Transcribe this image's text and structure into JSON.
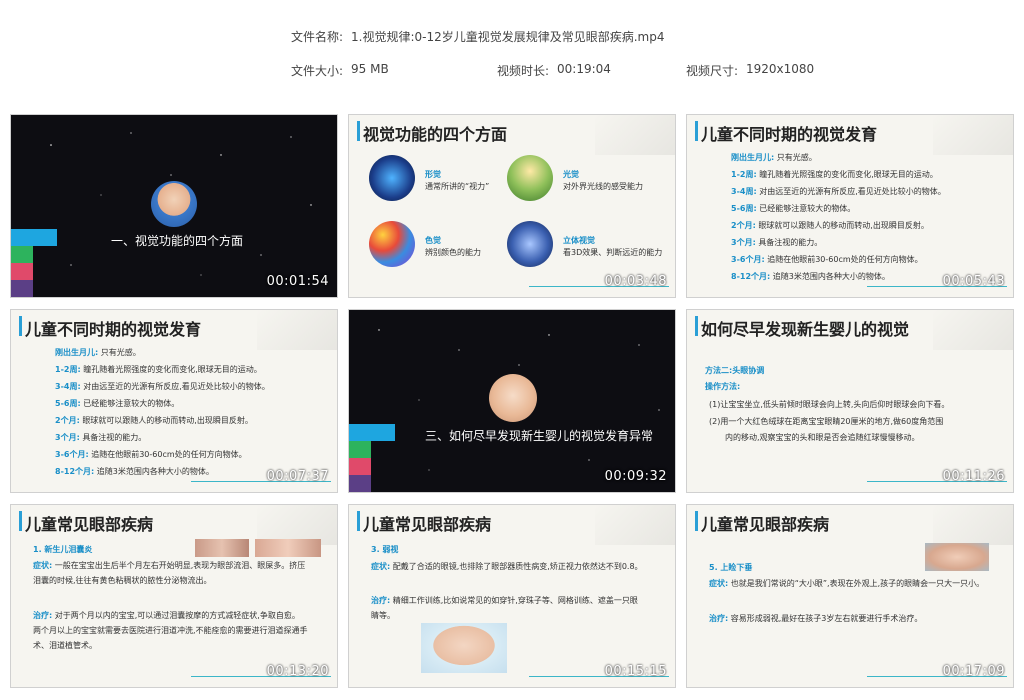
{
  "file_info": {
    "name_label": "文件名称:",
    "name_value": "1.视觉规律:0-12岁儿童视觉发展规律及常见眼部疾病.mp4",
    "size_label": "文件大小:",
    "size_value": "95 MB",
    "duration_label": "视频时长:",
    "duration_value": "00:19:04",
    "dimension_label": "视频尺寸:",
    "dimension_value": "1920x1080"
  },
  "thumbs": [
    {
      "timestamp": "00:01:54",
      "title": "一、视觉功能的四个方面"
    },
    {
      "timestamp": "00:03:48",
      "title": "视觉功能的四个方面",
      "features": [
        {
          "label": "形觉",
          "desc": "通常所讲的“视力”"
        },
        {
          "label": "光觉",
          "desc": "对外界光线的感受能力"
        },
        {
          "label": "色觉",
          "desc": "辨别颜色的能力"
        },
        {
          "label": "立体视觉",
          "desc": "看3D效果、判断远近的能力"
        }
      ]
    },
    {
      "timestamp": "00:05:43",
      "title": "儿童不同时期的视觉发育",
      "items": [
        {
          "k": "刚出生月儿:",
          "v": "只有光感。"
        },
        {
          "k": "1-2周:",
          "v": "瞳孔随着光照强度的变化而变化,眼球无目的运动。"
        },
        {
          "k": "3-4周:",
          "v": "对由远至近的光源有所反应,看见近处比较小的物体。"
        },
        {
          "k": "5-6周:",
          "v": "已经能够注意较大的物体。"
        },
        {
          "k": "2个月:",
          "v": "眼球就可以跟随人的移动而转动,出现瞬目反射。"
        },
        {
          "k": "3个月:",
          "v": "具备注视的能力。"
        },
        {
          "k": "3-6个月:",
          "v": "追随在他眼前30-60cm处的任何方向物体。"
        },
        {
          "k": "8-12个月:",
          "v": "追随3米范围内各种大小的物体。"
        }
      ]
    },
    {
      "timestamp": "00:07:37",
      "title": "儿童不同时期的视觉发育",
      "items": [
        {
          "k": "刚出生月儿:",
          "v": "只有光感。"
        },
        {
          "k": "1-2周:",
          "v": "瞳孔随着光照强度的变化而变化,眼球无目的运动。"
        },
        {
          "k": "3-4周:",
          "v": "对由远至近的光源有所反应,看见近处比较小的物体。"
        },
        {
          "k": "5-6周:",
          "v": "已经能够注意较大的物体。"
        },
        {
          "k": "2个月:",
          "v": "眼球就可以跟随人的移动而转动,出现瞬目反射。"
        },
        {
          "k": "3个月:",
          "v": "具备注视的能力。"
        },
        {
          "k": "3-6个月:",
          "v": "追随在他眼前30-60cm处的任何方向物体。"
        },
        {
          "k": "8-12个月:",
          "v": "追随3米范围内各种大小的物体。"
        }
      ]
    },
    {
      "timestamp": "00:09:32",
      "title": "三、如何尽早发现新生婴儿的视觉发育异常"
    },
    {
      "timestamp": "00:11:26",
      "title": "如何尽早发现新生婴儿的视觉",
      "method": "方法二:头眼协调",
      "op": "操作方法:",
      "p1": "(1)让宝宝坐立,低头前倾时眼球会向上转,头向后仰时眼球会向下看。",
      "p2a": "(2)用一个大红色绒球在距离宝宝眼睛20厘米的地方,做60度角范围",
      "p2b": "内的移动,观察宝宝的头和眼是否会追随红球慢慢移动。"
    },
    {
      "timestamp": "00:13:20",
      "title": "儿童常见眼部疾病",
      "sub": "1. 新生儿泪囊炎",
      "sym_k": "症状:",
      "sym_v1": "一般在宝宝出生后半个月左右开始明显,表现为眼部流泪、眼屎多。挤压",
      "sym_v2": "泪囊的时候,往往有黄色粘稠状的脓性分泌物流出。",
      "treat_k": "治疗:",
      "treat_v1": "对于两个月以内的宝宝,可以通过泪囊按摩的方式减轻症状,争取自愈。",
      "treat_v2": "两个月以上的宝宝就需要去医院进行泪道冲洗,不能痊愈的需要进行泪道探通手",
      "treat_v3": "术、泪道植管术。"
    },
    {
      "timestamp": "00:15:15",
      "title": "儿童常见眼部疾病",
      "sub": "3. 弱视",
      "sym_k": "症状:",
      "sym_v": "配戴了合适的眼镜,也排除了眼部器质性病变,矫正视力依然达不到0.8。",
      "treat_k": "治疗:",
      "treat_v1": "精细工作训练,比如说常见的如穿针,穿珠子等、网格训练、遮盖一只眼",
      "treat_v2": "睛等。"
    },
    {
      "timestamp": "00:17:09",
      "title": "儿童常见眼部疾病",
      "sub": "5. 上睑下垂",
      "sym_k": "症状:",
      "sym_v": "也就是我们常说的“大小眼”,表现在外观上,孩子的眼睛会一只大一只小。",
      "treat_k": "治疗:",
      "treat_v": "容易形成弱视,最好在孩子3岁左右就要进行手术治疗。"
    }
  ]
}
